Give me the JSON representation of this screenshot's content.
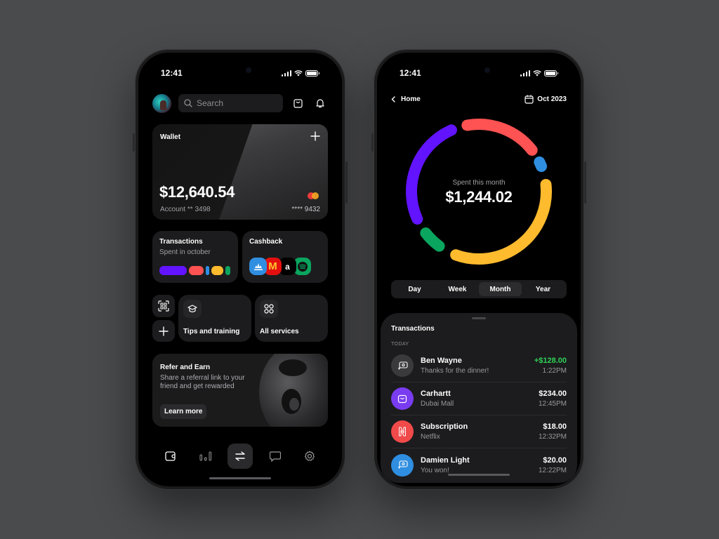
{
  "status_bar": {
    "time": "12:41"
  },
  "colors": {
    "purple": "#6213ff",
    "red": "#ff5252",
    "blue": "#2f8ee0",
    "yellow": "#ffbb2e",
    "green": "#0aa55e",
    "positive": "#30d158"
  },
  "home": {
    "search_placeholder": "Search",
    "wallet": {
      "label": "Wallet",
      "balance": "$12,640.54",
      "account": "Account ** 3498",
      "card_number": "**** 9432"
    },
    "transactions_tile": {
      "title": "Transactions",
      "subtitle": "Spent in october"
    },
    "cashback_tile": {
      "title": "Cashback",
      "brands": [
        "adidas",
        "McDonald's",
        "Amazon",
        "Spotify"
      ]
    },
    "tips_tile": {
      "title": "Tips and training"
    },
    "services_tile": {
      "title": "All services"
    },
    "refer": {
      "title": "Refer and Earn",
      "body": "Share a referral link to your friend and get rewarded",
      "button": "Learn more"
    },
    "tabbar": [
      "wallet",
      "analytics",
      "transfer",
      "messages",
      "settings"
    ],
    "active_tab": "transfer"
  },
  "analytics": {
    "back_label": "Home",
    "period": "Oct 2023",
    "spent_label": "Spent this month",
    "spent_value": "$1,244.02",
    "segments": [
      "Day",
      "Week",
      "Month",
      "Year"
    ],
    "active_segment": "Month",
    "transactions_title": "Transactions",
    "section_label": "TODAY",
    "transactions": [
      {
        "name": "Ben Wayne",
        "note": "Thanks for the dinner!",
        "amount": "+$128.00",
        "time": "1:22PM",
        "icon": "money-transfer-icon",
        "color": "#3a3a3c",
        "positive": true
      },
      {
        "name": "Carhartt",
        "note": "Dubai Mall",
        "amount": "$234.00",
        "time": "12:45PM",
        "icon": "shopping-bag-icon",
        "color": "#7a3cf0",
        "positive": false
      },
      {
        "name": "Subscription",
        "note": "Netflix",
        "amount": "$18.00",
        "time": "12:32PM",
        "icon": "netflix-icon",
        "color": "#f04a4a",
        "positive": false
      },
      {
        "name": "Damien Light",
        "note": "You won!",
        "amount": "$20.00",
        "time": "12:22PM",
        "icon": "money-transfer-icon",
        "color": "#2f8ee0",
        "positive": false
      }
    ]
  }
}
